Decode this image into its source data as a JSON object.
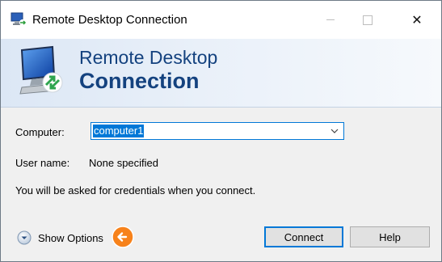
{
  "window": {
    "title": "Remote Desktop Connection",
    "close_glyph": "✕"
  },
  "banner": {
    "line1": "Remote Desktop",
    "line2": "Connection"
  },
  "form": {
    "computer_label": "Computer:",
    "computer_value": "computer1",
    "username_label": "User name:",
    "username_value": "None specified",
    "info_text": "You will be asked for credentials when you connect."
  },
  "footer": {
    "show_options_label": "Show Options",
    "connect_label": "Connect",
    "help_label": "Help"
  },
  "colors": {
    "accent": "#0078d7",
    "banner_text": "#14427f",
    "hint_badge": "#f7821b"
  }
}
